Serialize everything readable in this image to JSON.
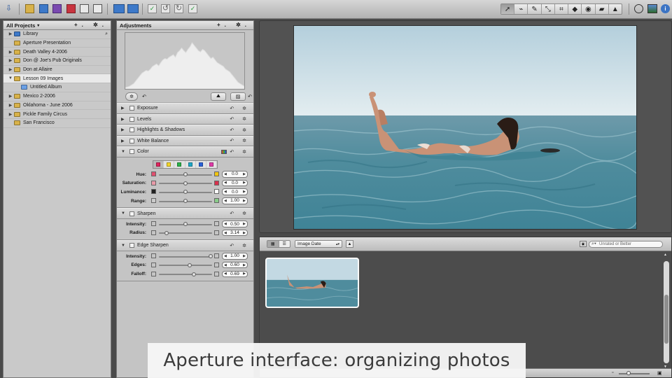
{
  "toolbar": {
    "left_icons": [
      "import-icon",
      "new-project-icon",
      "new-folder-icon",
      "new-album-icon",
      "new-smart-album-icon",
      "new-book-icon",
      "new-light-table-icon",
      "stack-icon",
      "split-stack-icon",
      "approve-icon",
      "rotate-left-icon",
      "rotate-right-icon",
      "check-icon"
    ],
    "tools": [
      "selection-tool-icon",
      "lift-stamp-icon",
      "retouch-icon",
      "straighten-icon",
      "crop-icon",
      "redeye-icon",
      "loupe-icon",
      "patch-icon",
      "repair-icon"
    ],
    "right_icons": [
      "viewer-mode-icon",
      "full-screen-icon",
      "info-icon"
    ]
  },
  "projects": {
    "header": "All Projects",
    "items": [
      {
        "label": "Library",
        "type": "library",
        "disclosure": "▶"
      },
      {
        "label": "Aperture Presentation",
        "type": "project",
        "disclosure": ""
      },
      {
        "label": "Death Valley 4-2006",
        "type": "project",
        "disclosure": "▶"
      },
      {
        "label": "Don @ Joe's Pub Originals",
        "type": "project",
        "disclosure": "▶"
      },
      {
        "label": "Don at Allaire",
        "type": "project",
        "disclosure": "▶"
      },
      {
        "label": "Lesson 09 Images",
        "type": "project",
        "disclosure": "▼",
        "selected": true
      },
      {
        "label": "Untitled Album",
        "type": "album",
        "disclosure": "",
        "indent": true
      },
      {
        "label": "Mexico 2-2006",
        "type": "project",
        "disclosure": "▶"
      },
      {
        "label": "Oklahoma - June 2006",
        "type": "project",
        "disclosure": "▶"
      },
      {
        "label": "Pickle Family Circus",
        "type": "project",
        "disclosure": "▶"
      },
      {
        "label": "San Francisco",
        "type": "project",
        "disclosure": ""
      }
    ]
  },
  "adjustments": {
    "header": "Adjustments",
    "histogram": [
      2,
      3,
      4,
      6,
      8,
      12,
      16,
      20,
      24,
      26,
      28,
      27,
      30,
      34,
      36,
      38,
      35,
      40,
      44,
      46,
      45,
      48,
      50,
      52,
      48,
      55,
      58,
      62,
      58,
      55,
      60,
      64,
      70,
      66,
      62,
      58,
      56,
      60,
      58,
      54,
      50,
      46,
      48,
      44,
      40,
      38,
      36,
      34,
      30,
      28,
      26,
      22,
      18,
      14,
      10,
      8,
      6,
      4
    ],
    "bricks": [
      {
        "label": "Exposure",
        "expanded": false
      },
      {
        "label": "Levels",
        "expanded": false
      },
      {
        "label": "Highlights & Shadows",
        "expanded": false
      },
      {
        "label": "White Balance",
        "expanded": false
      }
    ],
    "color": {
      "label": "Color",
      "swatches": [
        "#e0245e",
        "#f2d52b",
        "#2bb34a",
        "#20a8c8",
        "#2b63d8",
        "#e03ca8"
      ],
      "selected_swatch": 0,
      "rows": [
        {
          "label": "Hue:",
          "value": "0.0",
          "knob": 0.5,
          "left_color": "#e05070",
          "right_color": "#f1c40f"
        },
        {
          "label": "Saturation:",
          "value": "0.0",
          "knob": 0.5,
          "left_color": "#e89aa8",
          "right_color": "#d9304d"
        },
        {
          "label": "Luminance:",
          "value": "0.0",
          "knob": 0.5,
          "left_color": "#222222",
          "right_color": "#ffffff"
        },
        {
          "label": "Range:",
          "value": "1.00",
          "knob": 0.5,
          "left_color": "#cccccc",
          "right_color": "#88cc88"
        }
      ]
    },
    "sharpen": {
      "label": "Sharpen",
      "rows": [
        {
          "label": "Intensity:",
          "value": "0.50",
          "knob": 0.5
        },
        {
          "label": "Radius:",
          "value": "3.14",
          "knob": 0.15
        }
      ]
    },
    "edge_sharpen": {
      "label": "Edge Sharpen",
      "rows": [
        {
          "label": "Intensity:",
          "value": "1.00",
          "knob": 0.97
        },
        {
          "label": "Edges:",
          "value": "0.60",
          "knob": 0.58
        },
        {
          "label": "Falloff:",
          "value": "0.69",
          "knob": 0.66
        }
      ]
    }
  },
  "browser": {
    "sort_label": "Image Date",
    "search_placeholder": "Unrated or Better"
  },
  "caption": "Aperture interface: organizing photos"
}
